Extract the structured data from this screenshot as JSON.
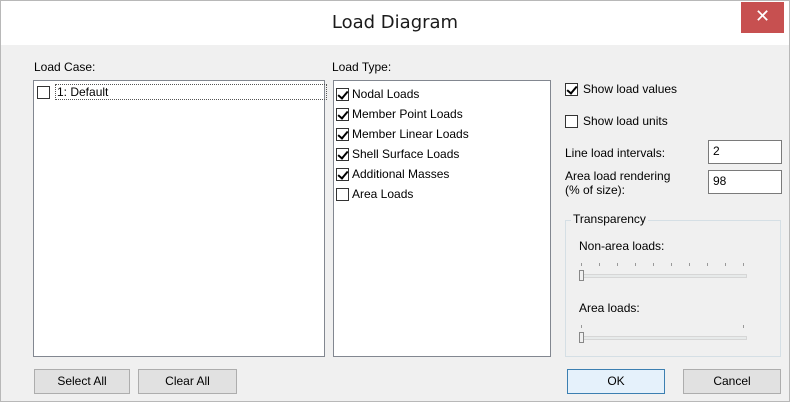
{
  "window": {
    "title": "Load Diagram",
    "close_glyph": "✕"
  },
  "load_case": {
    "label": "Load Case:",
    "items": [
      {
        "label": "1: Default",
        "checked": false
      }
    ]
  },
  "load_type": {
    "label": "Load Type:",
    "items": [
      {
        "label": "Nodal Loads",
        "checked": true
      },
      {
        "label": "Member Point Loads",
        "checked": true
      },
      {
        "label": "Member Linear Loads",
        "checked": true
      },
      {
        "label": "Shell Surface Loads",
        "checked": true
      },
      {
        "label": "Additional Masses",
        "checked": true
      },
      {
        "label": "Area Loads",
        "checked": false
      }
    ]
  },
  "options": {
    "show_load_values": {
      "label": "Show load values",
      "checked": true
    },
    "show_load_units": {
      "label": "Show load units",
      "checked": false
    },
    "line_load_intervals": {
      "label": "Line load intervals:",
      "value": "2"
    },
    "area_load_rendering": {
      "label_line1": "Area load rendering",
      "label_line2": "(% of size):",
      "value": "98"
    }
  },
  "transparency": {
    "title": "Transparency",
    "non_area_loads": {
      "label": "Non-area loads:",
      "value": 0
    },
    "area_loads": {
      "label": "Area loads:",
      "value": 0
    }
  },
  "buttons": {
    "select_all": "Select All",
    "clear_all": "Clear All",
    "ok": "OK",
    "cancel": "Cancel"
  },
  "colors": {
    "close_button": "#c75050",
    "ok_border": "#3c7fb1"
  }
}
